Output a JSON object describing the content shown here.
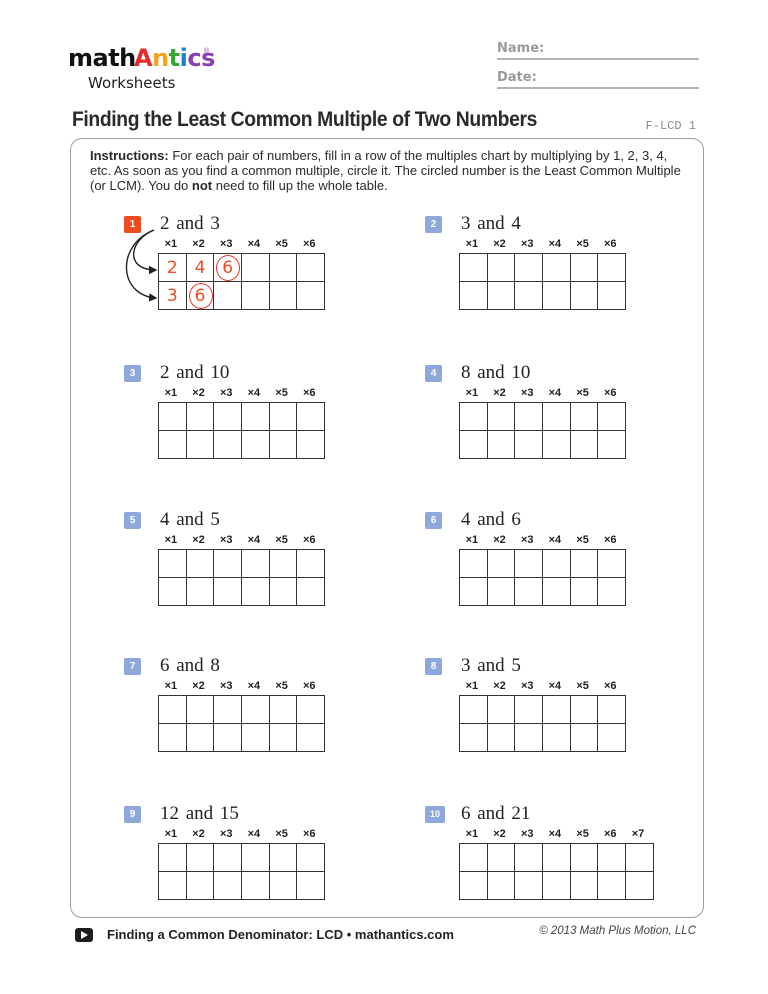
{
  "logo": {
    "math": "math",
    "antics_letters": [
      {
        "ch": "A",
        "color": "#e32d2d"
      },
      {
        "ch": "n",
        "color": "#f2a21b"
      },
      {
        "ch": "t",
        "color": "#3aa637"
      },
      {
        "ch": "i",
        "color": "#1f7fd1"
      },
      {
        "ch": "c",
        "color": "#8a3fb6"
      },
      {
        "ch": "s",
        "color": "#8a3fb6"
      }
    ],
    "registered": "®",
    "subtitle": "Worksheets"
  },
  "fields": {
    "name_label": "Name:",
    "date_label": "Date:"
  },
  "header": {
    "title": "Finding the Least Common Multiple of Two Numbers",
    "code": "F-LCD 1"
  },
  "instructions": {
    "lead": "Instructions:",
    "part1": "  For each pair of numbers, fill in a row of the multiples chart by multiplying by 1, 2, 3, 4, etc.  As soon as you find a common multiple, circle it.  The circled number is the Least Common Multiple (or LCM).  You do ",
    "bold": "not",
    "part2": " need to fill up the whole table."
  },
  "colors": {
    "accent": "#ef4b23",
    "badge": "#8ea8dc",
    "circle": "#e8362a"
  },
  "problems": [
    {
      "num": "1",
      "prompt": "2  and  3",
      "example": true,
      "headers": [
        "×1",
        "×2",
        "×3",
        "×4",
        "×5",
        "×6"
      ],
      "rows": [
        [
          "2",
          "4",
          "6",
          "",
          "",
          ""
        ],
        [
          "3",
          "6",
          "",
          "",
          "",
          ""
        ]
      ],
      "circled": [
        [
          0,
          2
        ],
        [
          1,
          1
        ]
      ]
    },
    {
      "num": "2",
      "prompt": "3  and  4",
      "headers": [
        "×1",
        "×2",
        "×3",
        "×4",
        "×5",
        "×6"
      ],
      "rows": [
        [
          "",
          "",
          "",
          "",
          "",
          ""
        ],
        [
          "",
          "",
          "",
          "",
          "",
          ""
        ]
      ]
    },
    {
      "num": "3",
      "prompt": "2  and  10",
      "headers": [
        "×1",
        "×2",
        "×3",
        "×4",
        "×5",
        "×6"
      ],
      "rows": [
        [
          "",
          "",
          "",
          "",
          "",
          ""
        ],
        [
          "",
          "",
          "",
          "",
          "",
          ""
        ]
      ]
    },
    {
      "num": "4",
      "prompt": "8  and  10",
      "headers": [
        "×1",
        "×2",
        "×3",
        "×4",
        "×5",
        "×6"
      ],
      "rows": [
        [
          "",
          "",
          "",
          "",
          "",
          ""
        ],
        [
          "",
          "",
          "",
          "",
          "",
          ""
        ]
      ]
    },
    {
      "num": "5",
      "prompt": "4  and  5",
      "headers": [
        "×1",
        "×2",
        "×3",
        "×4",
        "×5",
        "×6"
      ],
      "rows": [
        [
          "",
          "",
          "",
          "",
          "",
          ""
        ],
        [
          "",
          "",
          "",
          "",
          "",
          ""
        ]
      ]
    },
    {
      "num": "6",
      "prompt": "4  and  6",
      "headers": [
        "×1",
        "×2",
        "×3",
        "×4",
        "×5",
        "×6"
      ],
      "rows": [
        [
          "",
          "",
          "",
          "",
          "",
          ""
        ],
        [
          "",
          "",
          "",
          "",
          "",
          ""
        ]
      ]
    },
    {
      "num": "7",
      "prompt": "6  and  8",
      "headers": [
        "×1",
        "×2",
        "×3",
        "×4",
        "×5",
        "×6"
      ],
      "rows": [
        [
          "",
          "",
          "",
          "",
          "",
          ""
        ],
        [
          "",
          "",
          "",
          "",
          "",
          ""
        ]
      ]
    },
    {
      "num": "8",
      "prompt": "3  and  5",
      "headers": [
        "×1",
        "×2",
        "×3",
        "×4",
        "×5",
        "×6"
      ],
      "rows": [
        [
          "",
          "",
          "",
          "",
          "",
          ""
        ],
        [
          "",
          "",
          "",
          "",
          "",
          ""
        ]
      ]
    },
    {
      "num": "9",
      "prompt": "12  and  15",
      "headers": [
        "×1",
        "×2",
        "×3",
        "×4",
        "×5",
        "×6"
      ],
      "rows": [
        [
          "",
          "",
          "",
          "",
          "",
          ""
        ],
        [
          "",
          "",
          "",
          "",
          "",
          ""
        ]
      ]
    },
    {
      "num": "10",
      "prompt": "6  and  21",
      "headers": [
        "×1",
        "×2",
        "×3",
        "×4",
        "×5",
        "×6",
        "×7"
      ],
      "rows": [
        [
          "",
          "",
          "",
          "",
          "",
          "",
          ""
        ],
        [
          "",
          "",
          "",
          "",
          "",
          "",
          ""
        ]
      ]
    }
  ],
  "footer": {
    "video_icon": "play-icon",
    "link_text": "Finding a Common Denominator: LCD • mathantics.com",
    "copyright": "© 2013 Math Plus Motion, LLC"
  }
}
